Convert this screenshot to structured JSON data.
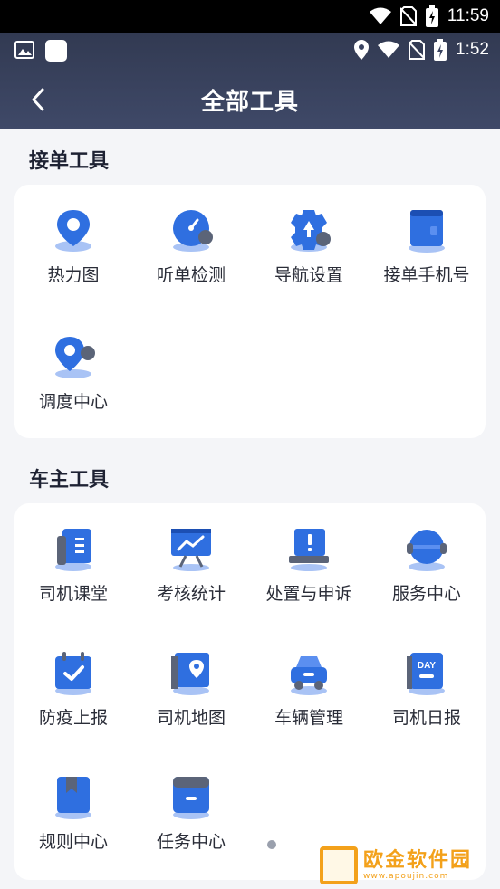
{
  "system_status": {
    "time": "11:59"
  },
  "app_status": {
    "time": "1:52"
  },
  "header": {
    "title": "全部工具"
  },
  "sections": [
    {
      "title": "接单工具",
      "items": [
        {
          "label": "热力图",
          "icon": "map-pin-icon"
        },
        {
          "label": "听单检测",
          "icon": "speedometer-icon"
        },
        {
          "label": "导航设置",
          "icon": "navigation-gear-icon"
        },
        {
          "label": "接单手机号",
          "icon": "phone-card-icon"
        },
        {
          "label": "调度中心",
          "icon": "dispatch-pin-icon"
        }
      ]
    },
    {
      "title": "车主工具",
      "items": [
        {
          "label": "司机课堂",
          "icon": "book-icon"
        },
        {
          "label": "考核统计",
          "icon": "chart-board-icon"
        },
        {
          "label": "处置与申诉",
          "icon": "alert-laptop-icon"
        },
        {
          "label": "服务中心",
          "icon": "headset-icon"
        },
        {
          "label": "防疫上报",
          "icon": "calendar-check-icon"
        },
        {
          "label": "司机地图",
          "icon": "folded-map-icon"
        },
        {
          "label": "车辆管理",
          "icon": "car-icon"
        },
        {
          "label": "司机日报",
          "icon": "day-calendar-icon"
        },
        {
          "label": "规则中心",
          "icon": "bookmark-book-icon"
        },
        {
          "label": "任务中心",
          "icon": "task-folder-icon"
        }
      ]
    }
  ],
  "watermark": {
    "name": "欧金软件园",
    "url": "www.apoujin.com"
  },
  "colors": {
    "accent": "#2f6fe0",
    "header": "#3a4360"
  }
}
